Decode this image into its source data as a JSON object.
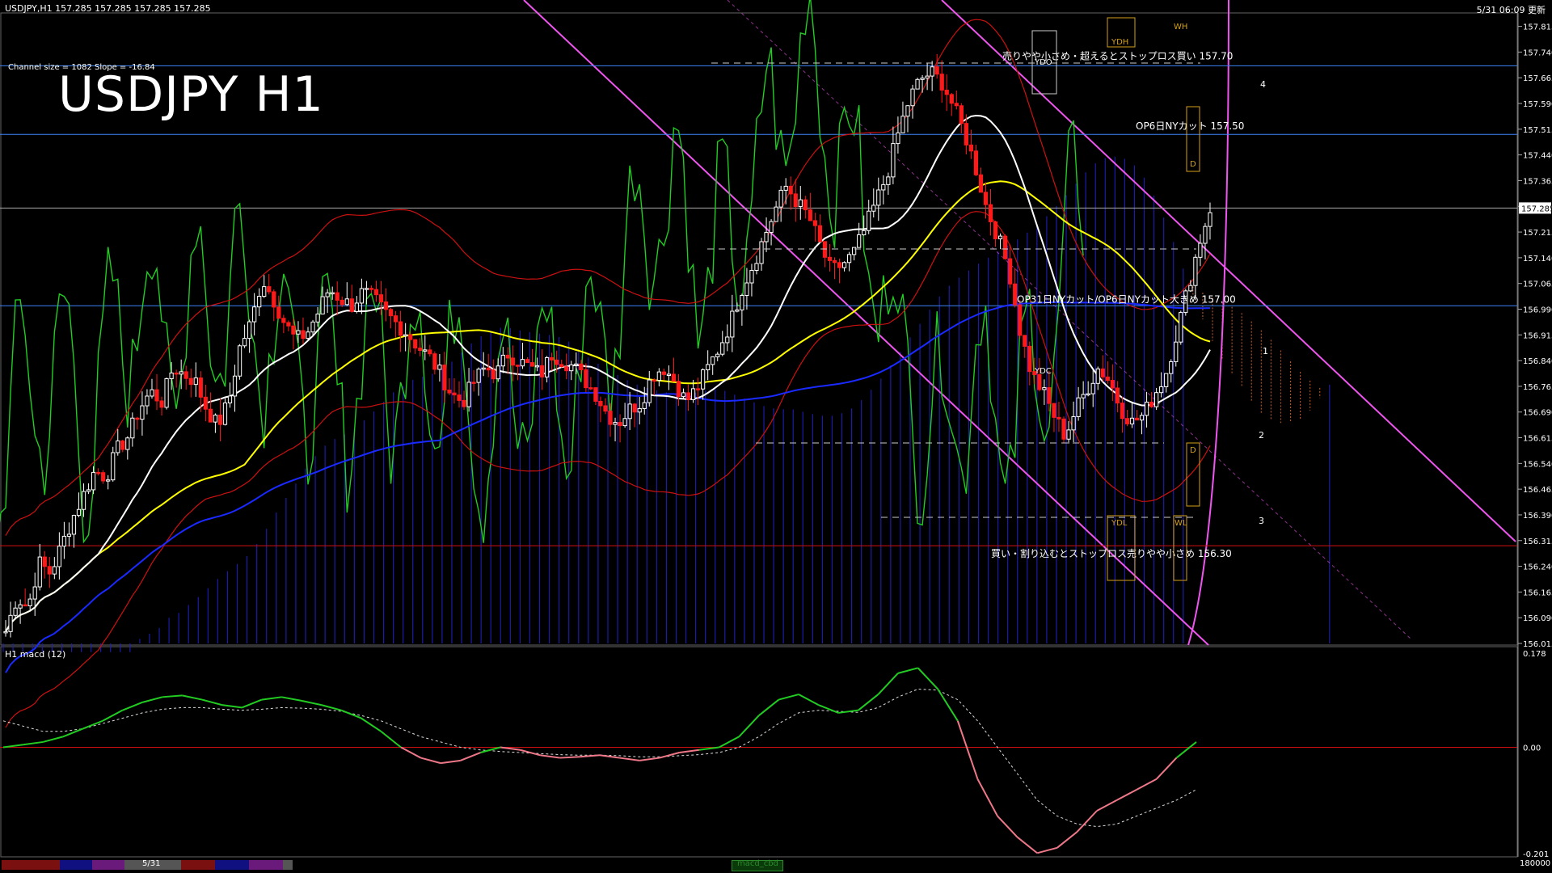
{
  "header": {
    "symbol_info": "USDJPY,H1   157.285 157.285 157.285 157.285",
    "datetime": "5/31 06:09 更新"
  },
  "overlay": {
    "title": "USDJPY H1",
    "channel_info": "Channel size = 1082  Slope = -16.84"
  },
  "annotations": {
    "sell_stop": "売りやや小さめ・超えるとストップロス買い 157.70",
    "cut_op6": "OP6日NYカット 157.50",
    "cut_op31": "OP31日NYカット/OP6日NYカット大きめ 157.00",
    "buy_stop": "買い・割り込むとストップロス売りやや小さめ 156.30",
    "ydh": "YDH",
    "ydo": "YDO",
    "ydc": "YDC",
    "ydl": "YDL",
    "wh": "WH",
    "wl": "WL",
    "d_upper": "D",
    "d_lower": "D",
    "n1": "1",
    "n2": "2",
    "n3": "3",
    "n4": "4"
  },
  "price_axis": {
    "ticks": [
      "157.815",
      "157.740",
      "157.665",
      "157.590",
      "157.515",
      "157.440",
      "157.365",
      "157.290",
      "157.215",
      "157.140",
      "157.065",
      "156.990",
      "156.915",
      "156.840",
      "156.765",
      "156.690",
      "156.615",
      "156.540",
      "156.465",
      "156.390",
      "156.315",
      "156.240",
      "156.165",
      "156.090",
      "156.015"
    ],
    "current": "157.285"
  },
  "macd_panel": {
    "label": "H1  macd (12)",
    "ticks": [
      "0.178",
      "0.00",
      "-0.201"
    ]
  },
  "bottom": {
    "date_tab": "5/31",
    "indicator_tab": "macd_cbd",
    "corner": "180000"
  },
  "colors": {
    "bg": "#000000",
    "bull": "#ffffff",
    "bear": "#ff1a1a",
    "ma_fast": "#ffffff",
    "ma_mid": "#ffff00",
    "ma_slow": "#1a2aff",
    "chikou": "#22cc22",
    "bollinger": "#cc1111",
    "kumo_upper": "#c05a22",
    "kumo_lower": "#2020bb",
    "channel": "#ee55ee",
    "level_line": "#3b82f6",
    "level_red": "#d01010",
    "macd_pos": "#22cc22",
    "macd_neg": "#ee7788"
  },
  "chart_data": {
    "type": "candlestick",
    "title": "USDJPY H1",
    "ylim": [
      156.015,
      157.84
    ],
    "current_price": 157.285,
    "horizontal_levels": [
      157.7,
      157.5,
      157.0,
      156.3
    ],
    "close_path": [
      156.05,
      156.15,
      156.12,
      156.25,
      156.22,
      156.3,
      156.38,
      156.45,
      156.52,
      156.5,
      156.58,
      156.62,
      156.7,
      156.75,
      156.72,
      156.82,
      156.8,
      156.78,
      156.7,
      156.65,
      156.72,
      156.88,
      156.95,
      157.08,
      157.02,
      156.95,
      156.9,
      156.92,
      156.98,
      157.05,
      157.02,
      157.0,
      157.04,
      157.02,
      156.98,
      156.95,
      156.92,
      156.88,
      156.85,
      156.8,
      156.74,
      156.72,
      156.78,
      156.82,
      156.8,
      156.86,
      156.84,
      156.82,
      156.8,
      156.86,
      156.84,
      156.82,
      156.78,
      156.74,
      156.68,
      156.66,
      156.7,
      156.72,
      156.8,
      156.82,
      156.78,
      156.72,
      156.76,
      156.82,
      156.88,
      156.95,
      157.05,
      157.12,
      157.2,
      157.28,
      157.35,
      157.3,
      157.26,
      157.18,
      157.1,
      157.12,
      157.15,
      157.22,
      157.3,
      157.38,
      157.5,
      157.6,
      157.66,
      157.68,
      157.65,
      157.58,
      157.5,
      157.4,
      157.28,
      157.2,
      157.1,
      156.92,
      156.8,
      156.75,
      156.68,
      156.62,
      156.7,
      156.76,
      156.82,
      156.78,
      156.7,
      156.66,
      156.68,
      156.74,
      156.8,
      156.92,
      157.05,
      157.18,
      157.285
    ]
  },
  "macd_data": {
    "macd": [
      0.0,
      0.005,
      0.01,
      0.02,
      0.035,
      0.05,
      0.07,
      0.085,
      0.095,
      0.098,
      0.09,
      0.08,
      0.075,
      0.09,
      0.095,
      0.088,
      0.08,
      0.07,
      0.055,
      0.03,
      0.0,
      -0.02,
      -0.03,
      -0.025,
      -0.01,
      0.0,
      -0.005,
      -0.015,
      -0.02,
      -0.018,
      -0.015,
      -0.02,
      -0.025,
      -0.02,
      -0.01,
      -0.005,
      0.0,
      0.02,
      0.06,
      0.09,
      0.1,
      0.08,
      0.065,
      0.07,
      0.1,
      0.14,
      0.15,
      0.11,
      0.05,
      -0.06,
      -0.13,
      -0.17,
      -0.2,
      -0.19,
      -0.16,
      -0.12,
      -0.1,
      -0.08,
      -0.06,
      -0.02,
      0.01
    ],
    "signal": [
      0.05,
      0.04,
      0.03,
      0.03,
      0.035,
      0.045,
      0.055,
      0.065,
      0.072,
      0.075,
      0.075,
      0.072,
      0.07,
      0.072,
      0.075,
      0.074,
      0.072,
      0.068,
      0.06,
      0.05,
      0.035,
      0.02,
      0.01,
      0.0,
      -0.005,
      -0.008,
      -0.01,
      -0.012,
      -0.014,
      -0.015,
      -0.015,
      -0.016,
      -0.018,
      -0.018,
      -0.016,
      -0.014,
      -0.01,
      0.0,
      0.02,
      0.045,
      0.065,
      0.07,
      0.068,
      0.066,
      0.075,
      0.095,
      0.11,
      0.108,
      0.09,
      0.05,
      0.0,
      -0.05,
      -0.1,
      -0.13,
      -0.145,
      -0.15,
      -0.145,
      -0.13,
      -0.115,
      -0.1,
      -0.08
    ],
    "ylim": [
      -0.201,
      0.178
    ]
  }
}
